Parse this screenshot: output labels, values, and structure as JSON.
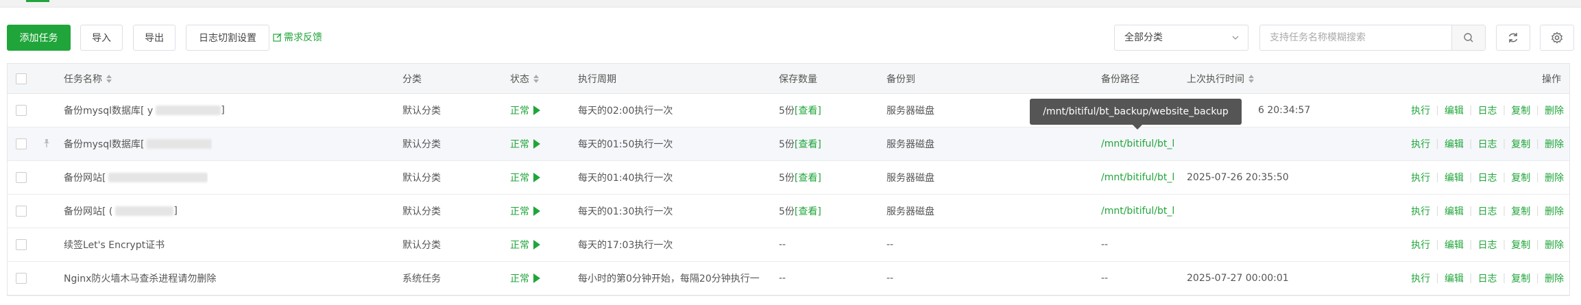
{
  "toolbar": {
    "add_label": "添加任务",
    "import_label": "导入",
    "export_label": "导出",
    "log_cut_label": "日志切割设置",
    "feedback_label": "需求反馈",
    "category_value": "全部分类",
    "search_placeholder": "支持任务名称模糊搜索"
  },
  "columns": {
    "name": "任务名称",
    "category": "分类",
    "status": "状态",
    "cycle": "执行周期",
    "keep": "保存数量",
    "backup_to": "备份到",
    "backup_path": "备份路径",
    "last_run": "上次执行时间",
    "ops": "操作"
  },
  "tooltip": "/mnt/bitiful/bt_backup/website_backup",
  "ops": {
    "run": "执行",
    "edit": "编辑",
    "log": "日志",
    "copy": "复制",
    "delete": "删除"
  },
  "rows": [
    {
      "name": "备份mysql数据库[ y",
      "name_end": " ]",
      "category": "默认分类",
      "status": "正常",
      "cycle": "每天的02:00执行一次",
      "keep": "5份",
      "keep_link": "[查看]",
      "backup_to": "服务器磁盘",
      "backup_path": "",
      "last_run": "6 20:34:57"
    },
    {
      "name": "备份mysql数据库[",
      "name_end": "",
      "category": "默认分类",
      "status": "正常",
      "cycle": "每天的01:50执行一次",
      "keep": "5份",
      "keep_link": "[查看]",
      "backup_to": "服务器磁盘",
      "backup_path": "/mnt/bitiful/bt_l",
      "last_run": ""
    },
    {
      "name": "备份网站[",
      "name_end": "",
      "category": "默认分类",
      "status": "正常",
      "cycle": "每天的01:40执行一次",
      "keep": "5份",
      "keep_link": "[查看]",
      "backup_to": "服务器磁盘",
      "backup_path": "/mnt/bitiful/bt_l",
      "last_run": "2025-07-26 20:35:50"
    },
    {
      "name": "备份网站[ (",
      "name_end": "]",
      "category": "默认分类",
      "status": "正常",
      "cycle": "每天的01:30执行一次",
      "keep": "5份",
      "keep_link": "[查看]",
      "backup_to": "服务器磁盘",
      "backup_path": "/mnt/bitiful/bt_l",
      "last_run": ""
    },
    {
      "name": "续签Let's Encrypt证书",
      "name_end": "",
      "category": "默认分类",
      "status": "正常",
      "cycle": "每天的17:03执行一次",
      "keep": "--",
      "keep_link": "",
      "backup_to": "--",
      "backup_path": "--",
      "last_run": ""
    },
    {
      "name": "Nginx防火墙木马查杀进程请勿删除",
      "name_end": "",
      "category": "系统任务",
      "status": "正常",
      "cycle": "每小时的第0分钟开始，每隔20分钟执行一",
      "keep": "--",
      "keep_link": "",
      "backup_to": "--",
      "backup_path": "--",
      "last_run": "2025-07-27 00:00:01"
    }
  ]
}
